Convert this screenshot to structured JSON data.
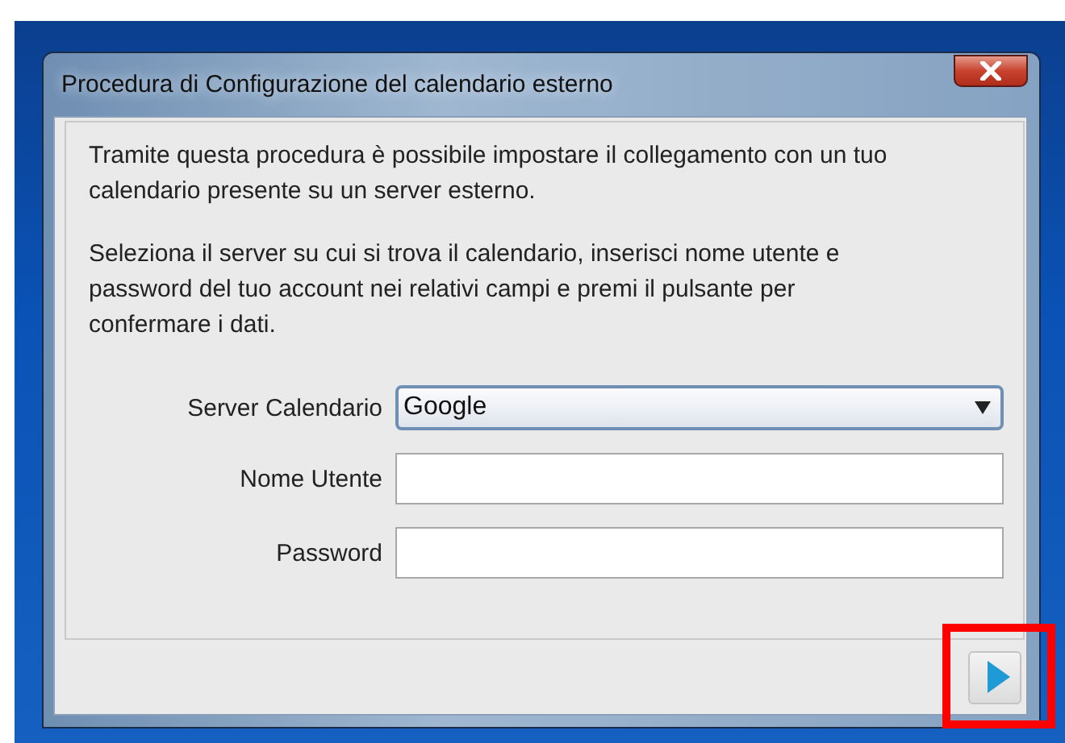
{
  "window": {
    "title": "Procedura di Configurazione del calendario esterno"
  },
  "intro": [
    "Tramite questa procedura è possibile impostare il collegamento con un tuo calendario presente su un server esterno.",
    "Seleziona il server su cui si trova il calendario, inserisci nome utente e password del tuo account nei relativi campi e premi il pulsante per confermare i dati."
  ],
  "form": [
    {
      "kind": "select",
      "label": "Server Calendario",
      "value": "Google"
    },
    {
      "kind": "text",
      "label": "Nome Utente"
    },
    {
      "kind": "password",
      "label": "Password"
    }
  ],
  "next_button": {
    "highlighted": true
  }
}
